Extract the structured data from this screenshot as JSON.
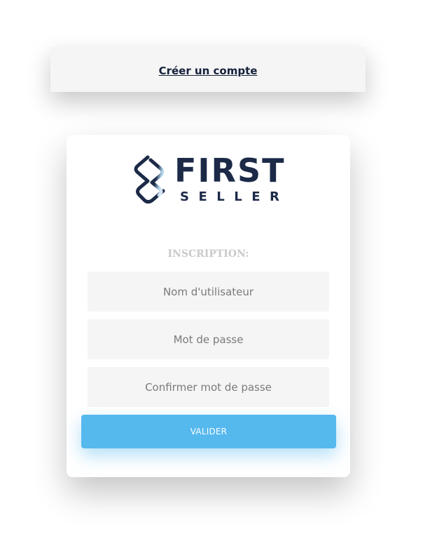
{
  "header": {
    "create_account_link": "Créer un compte"
  },
  "logo": {
    "line1": "FIRST",
    "line2": "SELLER",
    "icon": "first-seller-logo-mark"
  },
  "form": {
    "title": "INSCRIPTION:",
    "username_placeholder": "Nom d'utilisateur",
    "password_placeholder": "Mot de passe",
    "confirm_password_placeholder": "Confirmer mot de passe",
    "submit_label": "VALIDER"
  },
  "colors": {
    "brand_navy": "#1c2a48",
    "accent_blue": "#56b9ee",
    "field_background": "#f5f5f5",
    "title_gray": "#c9c9c9"
  }
}
